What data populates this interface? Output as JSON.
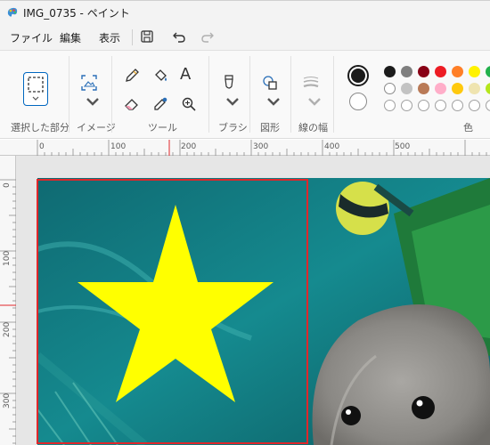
{
  "window": {
    "title": "IMG_0735 - ペイント"
  },
  "menu": {
    "file": "ファイル",
    "edit": "編集",
    "view": "表示"
  },
  "ribbon": {
    "groups": {
      "selection": "選択した部分",
      "image": "イメージ",
      "tools": "ツール",
      "brushes": "ブラシ",
      "shapes": "図形",
      "line_width": "線の幅",
      "colors": "色"
    },
    "text_tool_glyph": "A",
    "palette_row1": [
      "#1b1b1b",
      "#7f7f7f",
      "#880015",
      "#ed1c24",
      "#ff7f27",
      "#fff200",
      "#22b14c"
    ],
    "palette_row2": [
      "#ffffff",
      "#c3c3c3",
      "#b97a57",
      "#ffaec9",
      "#ffc90e",
      "#efe4b0",
      "#b5e61d"
    ],
    "primary_color": "#1b1b1b",
    "secondary_color": "#ffffff",
    "accent": "#0067c0"
  },
  "ruler": {
    "top_labels": [
      "0",
      "100",
      "200",
      "300",
      "400",
      "500"
    ],
    "left_labels": [
      "0",
      "100",
      "200",
      "300"
    ]
  },
  "canvas": {
    "selection_color": "#e0272b",
    "star_color": "#ffff00"
  }
}
